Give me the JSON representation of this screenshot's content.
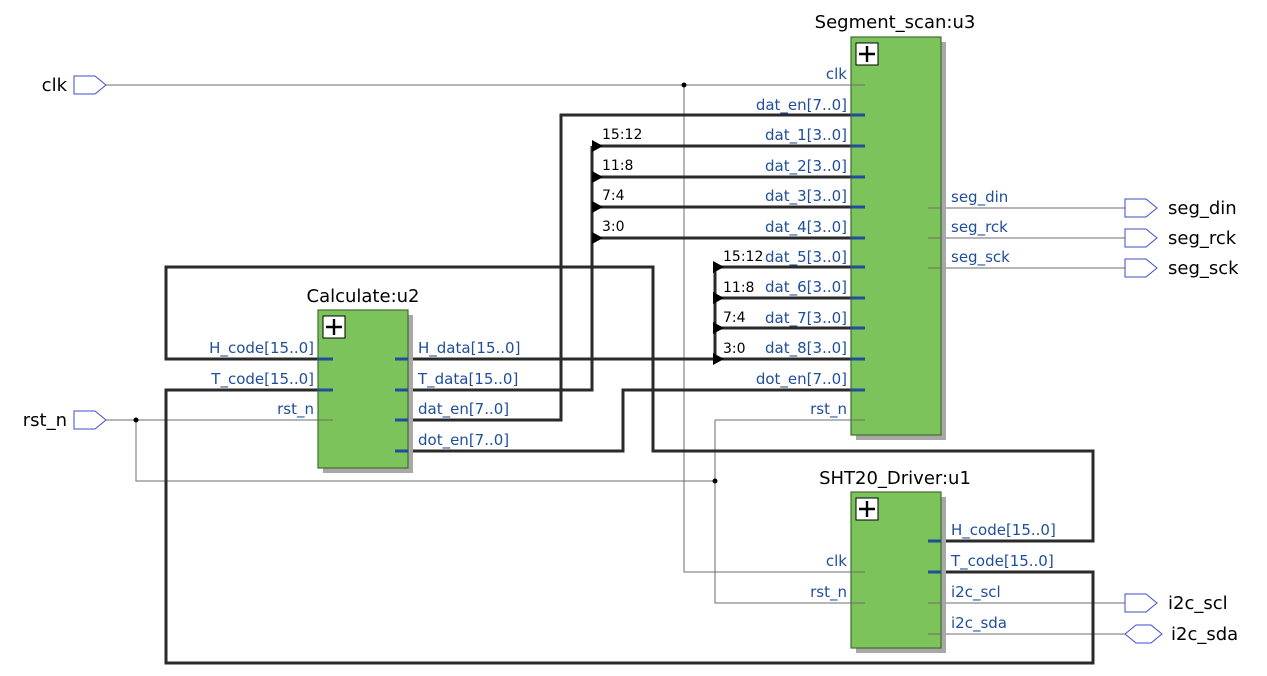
{
  "blocks": {
    "segment_scan": {
      "title": "Segment_scan:u3",
      "inputs": [
        "clk",
        "dat_en[7..0]",
        "dat_1[3..0]",
        "dat_2[3..0]",
        "dat_3[3..0]",
        "dat_4[3..0]",
        "dat_5[3..0]",
        "dat_6[3..0]",
        "dat_7[3..0]",
        "dat_8[3..0]",
        "dot_en[7..0]",
        "rst_n"
      ],
      "outputs": [
        "seg_din",
        "seg_rck",
        "seg_sck"
      ]
    },
    "calculate": {
      "title": "Calculate:u2",
      "inputs": [
        "H_code[15..0]",
        "T_code[15..0]",
        "rst_n"
      ],
      "outputs": [
        "H_data[15..0]",
        "T_data[15..0]",
        "dat_en[7..0]",
        "dot_en[7..0]"
      ]
    },
    "sht20_driver": {
      "title": "SHT20_Driver:u1",
      "inputs": [
        "clk",
        "rst_n"
      ],
      "outputs": [
        "H_code[15..0]",
        "T_code[15..0]",
        "i2c_scl",
        "i2c_sda"
      ]
    }
  },
  "io_ports": {
    "clk": "clk",
    "rst_n": "rst_n",
    "seg_din": "seg_din",
    "seg_rck": "seg_rck",
    "seg_sck": "seg_sck",
    "i2c_scl": "i2c_scl",
    "i2c_sda": "i2c_sda"
  },
  "bit_slices": {
    "t_data": [
      "15:12",
      "11:8",
      "7:4",
      "3:0"
    ],
    "h_data": [
      "15:12",
      "11:8",
      "7:4",
      "3:0"
    ]
  }
}
